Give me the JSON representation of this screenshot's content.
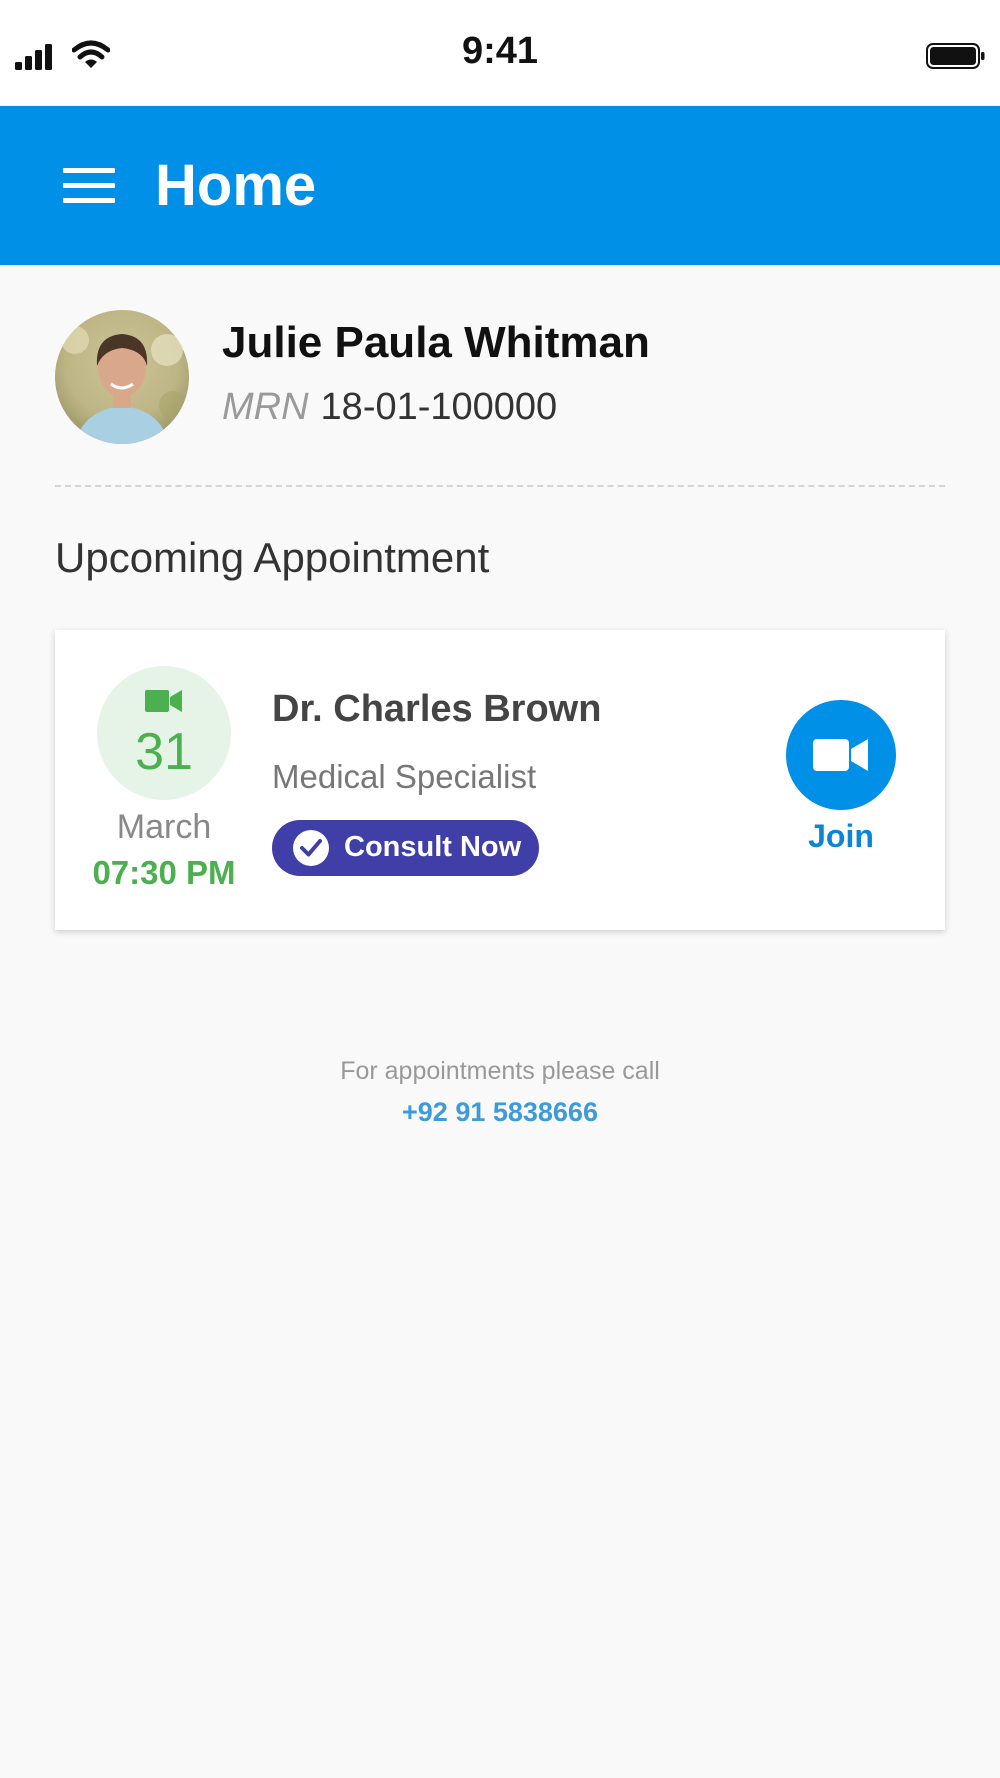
{
  "status_bar": {
    "time": "9:41",
    "icons": [
      "signal-icon",
      "wifi-icon",
      "battery-icon"
    ]
  },
  "app_bar": {
    "title": "Home",
    "menu_icon": "menu-icon",
    "color": "#0090e8"
  },
  "patient": {
    "name": "Julie Paula Whitman",
    "mrn_label": "MRN",
    "mrn": "18-01-100000"
  },
  "section": {
    "title": "Upcoming Appointment"
  },
  "appointment": {
    "day": "31",
    "month": "March",
    "time": "07:30 PM",
    "doctor": "Dr. Charles Brown",
    "specialty": "Medical Specialist",
    "consult_label": "Consult Now",
    "join_label": "Join",
    "date_icon": "video-camera-icon",
    "accent_green": "#4caf50",
    "consult_color": "#3f3fa7"
  },
  "footer": {
    "text": "For appointments please call",
    "phone": "+92 91 5838666"
  }
}
